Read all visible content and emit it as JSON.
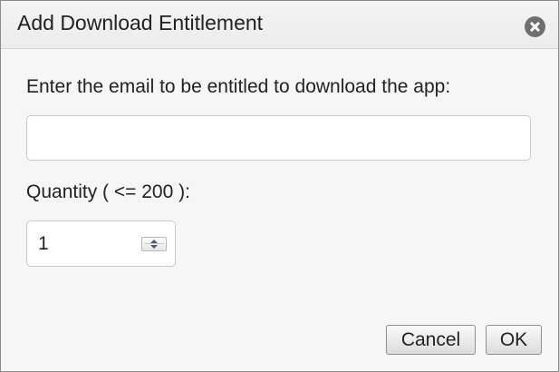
{
  "dialog": {
    "title": "Add Download Entitlement",
    "close_icon": "close-circle-icon"
  },
  "email": {
    "label": "Enter the email to be entitled to download the app:",
    "value": "",
    "placeholder": ""
  },
  "quantity": {
    "label": "Quantity ( <= 200 ):",
    "value": "1",
    "spinner_icon": "up-down-arrows-icon"
  },
  "buttons": {
    "cancel_label": "Cancel",
    "ok_label": "OK"
  },
  "colors": {
    "dialog_background": "#f6f6f6",
    "titlebar_background": "#ececec",
    "close_icon": "#6f6f6f"
  }
}
